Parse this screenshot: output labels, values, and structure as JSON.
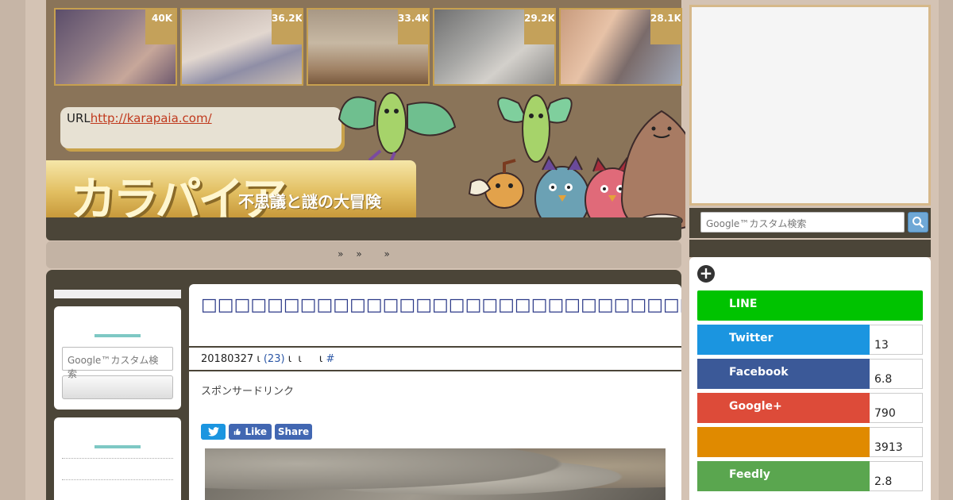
{
  "thumbnails": [
    {
      "count": "40K"
    },
    {
      "count": "36.2K"
    },
    {
      "count": "33.4K"
    },
    {
      "count": "29.2K"
    },
    {
      "count": "28.1K"
    }
  ],
  "header": {
    "url_label": "URL",
    "url_link": "http://karapaia.com/",
    "logo": "カラパイア",
    "tagline": "不思議と謎の大冒険"
  },
  "nav": {
    "items": [
      "»",
      "»",
      "»"
    ]
  },
  "sidebar_search": {
    "placeholder": "Google™カスタム検索"
  },
  "article": {
    "title": "□□□□□□□□□□□□□□□□□□□□□□□□□□□□□□□□□□□□□□□□□□□□□□□□□□□□□□□",
    "date": "20180327",
    "meta_sep1": "ι",
    "comments": "(23)",
    "meta_sep2": "ι  ι",
    "meta_sep3": "ι",
    "hash": "#",
    "sponsor": "スポンサードリンク",
    "share_like": "Like",
    "share_share": "Share"
  },
  "right_search": {
    "placeholder": "Google™カスタム検索"
  },
  "share_counts": [
    {
      "label": "LINE",
      "count": "",
      "color": "#00c300"
    },
    {
      "label": "Twitter",
      "count": "13",
      "color": "#1b95e0"
    },
    {
      "label": "Facebook",
      "count": "6.8",
      "color": "#3b5998"
    },
    {
      "label": "Google+",
      "count": "790",
      "color": "#dd4b39"
    },
    {
      "label": "",
      "count": "3913",
      "color": "#e08a00"
    },
    {
      "label": "Feedly",
      "count": "2.8",
      "color": "#5aa64f"
    }
  ]
}
